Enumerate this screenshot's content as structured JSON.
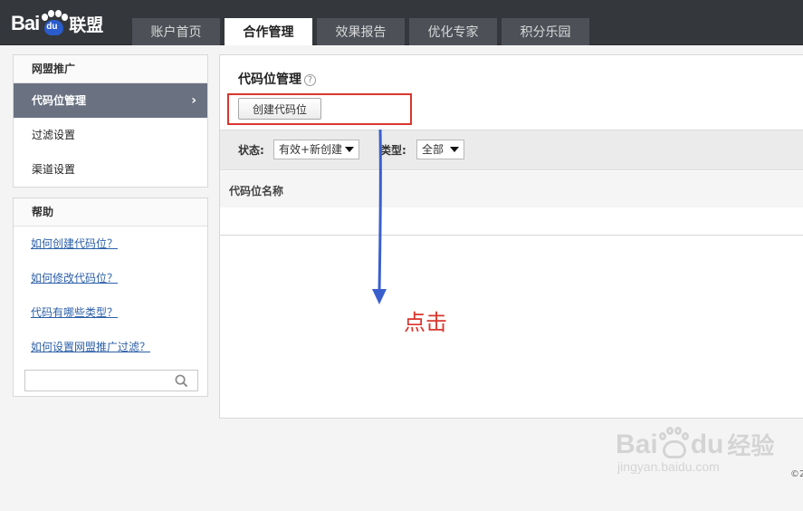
{
  "brand": {
    "logo_text_left": "Bai",
    "logo_paw_text": "du",
    "logo_text_right": "联盟"
  },
  "tabs": [
    {
      "label": "账户首页",
      "active": false
    },
    {
      "label": "合作管理",
      "active": true
    },
    {
      "label": "效果报告",
      "active": false
    },
    {
      "label": "优化专家",
      "active": false
    },
    {
      "label": "积分乐园",
      "active": false
    }
  ],
  "sidebar": {
    "section_title": "网盟推广",
    "items": [
      {
        "label": "代码位管理",
        "active": true,
        "chevron": "›"
      },
      {
        "label": "过滤设置",
        "active": false
      },
      {
        "label": "渠道设置",
        "active": false
      }
    ]
  },
  "help": {
    "title": "帮助",
    "links": [
      "如何创建代码位？",
      "如何修改代码位？",
      "代码有哪些类型？",
      "如何设置网盟推广过滤？"
    ],
    "search_value": ""
  },
  "main": {
    "title": "代码位管理",
    "help_icon": "?",
    "create_button": "创建代码位",
    "filters": {
      "status_label": "状态:",
      "status_value": "有效+新创建",
      "type_label": "类型:",
      "type_value": "全部"
    },
    "table": {
      "columns": [
        "代码位名称"
      ]
    }
  },
  "annotation": {
    "text": "点击",
    "color": "#d9362e",
    "arrow_color": "#3a5fcd"
  },
  "watermark": {
    "brand_left": "Bai",
    "brand_paw": "du",
    "brand_cn": "经验",
    "url": "jingyan.baidu.com"
  },
  "footer": {
    "copyright_fragment": "©2"
  },
  "colors": {
    "topbar": "#34373c",
    "tab_inactive": "#4d5157",
    "nav_active": "#6a7282",
    "link": "#2b5fa8",
    "highlight": "#d9362e"
  }
}
